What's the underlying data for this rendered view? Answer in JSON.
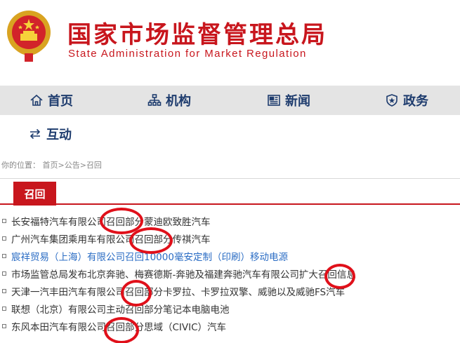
{
  "header": {
    "title": "国家市场监督管理总局",
    "subtitle": "State Administration for Market Regulation",
    "emblem_icon": "national-emblem-icon"
  },
  "nav": {
    "items": [
      {
        "label": "首页",
        "icon": "home-icon"
      },
      {
        "label": "机构",
        "icon": "org-chart-icon"
      },
      {
        "label": "新闻",
        "icon": "newspaper-icon"
      },
      {
        "label": "政务",
        "icon": "shield-star-icon"
      },
      {
        "label": "互动",
        "icon": "exchange-arrows-icon"
      }
    ]
  },
  "breadcrumb": {
    "prefix": "你的位置：",
    "items": [
      "首页",
      "公告",
      "召回"
    ],
    "separator": ">"
  },
  "section": {
    "tab_label": "召回"
  },
  "list": {
    "items": [
      {
        "text": "长安福特汽车有限公司召回部分蒙迪欧致胜汽车"
      },
      {
        "text": "广州汽车集团乘用车有限公司召回部分传祺汽车"
      },
      {
        "text": "宸祥贸易（上海）有限公司召回10000毫安定制（印刷）移动电源"
      },
      {
        "text": "市场监管总局发布北京奔驰、梅赛德斯-奔驰及福建奔驰汽车有限公司扩大召回信息"
      },
      {
        "text": "天津一汽丰田汽车有限公司召回部分卡罗拉、卡罗拉双擎、威驰以及威驰FS汽车"
      },
      {
        "text": "联想（北京）有限公司主动召回部分笔记本电脑电池"
      },
      {
        "text": "东风本田汽车有限公司召回部分思域（CIVIC）汽车"
      }
    ]
  },
  "colors": {
    "brand_red": "#c8161d",
    "nav_text": "#1e3c6e",
    "link_blue": "#2a6cc4",
    "annotation_red": "#e0101a"
  }
}
